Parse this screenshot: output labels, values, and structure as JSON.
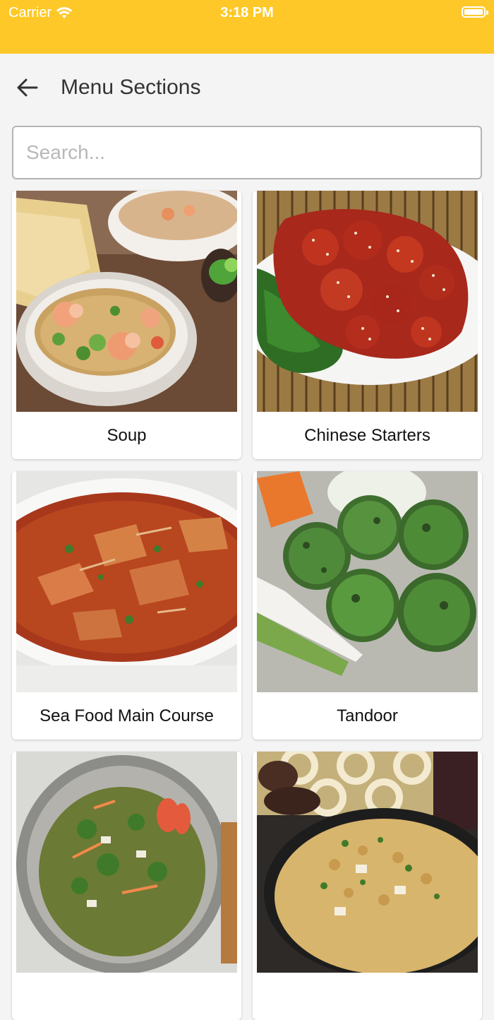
{
  "status_bar": {
    "carrier": "Carrier",
    "time": "3:18 PM"
  },
  "header": {
    "title": "Menu Sections"
  },
  "search": {
    "placeholder": "Search..."
  },
  "colors": {
    "accent": "#fec928",
    "background": "#f4f4f4"
  },
  "sections": [
    {
      "label": "Soup",
      "image": "soup-photo"
    },
    {
      "label": "Chinese Starters",
      "image": "chinese-starters-photo"
    },
    {
      "label": "Sea Food Main Course",
      "image": "sea-food-photo"
    },
    {
      "label": "Tandoor",
      "image": "tandoor-photo"
    },
    {
      "label": "",
      "image": "biryani-photo"
    },
    {
      "label": "",
      "image": "fried-rice-photo"
    }
  ]
}
